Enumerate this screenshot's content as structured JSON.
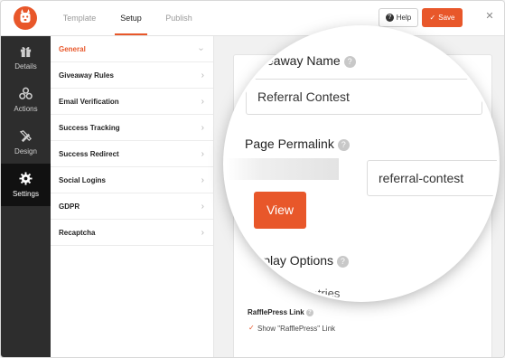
{
  "topbar": {
    "tabs": [
      {
        "label": "Template",
        "active": false
      },
      {
        "label": "Setup",
        "active": true
      },
      {
        "label": "Publish",
        "active": false
      }
    ],
    "help_label": "Help",
    "save_label": "Save",
    "close_glyph": "✕"
  },
  "leftnav": {
    "items": [
      {
        "label": "Details",
        "icon": "gift-icon",
        "active": false
      },
      {
        "label": "Actions",
        "icon": "actions-icon",
        "active": false
      },
      {
        "label": "Design",
        "icon": "design-icon",
        "active": false
      },
      {
        "label": "Settings",
        "icon": "gear-icon",
        "active": true
      }
    ]
  },
  "submenu": {
    "items": [
      {
        "label": "General",
        "active": true
      },
      {
        "label": "Giveaway Rules",
        "active": false
      },
      {
        "label": "Email Verification",
        "active": false
      },
      {
        "label": "Success Tracking",
        "active": false
      },
      {
        "label": "Success Redirect",
        "active": false
      },
      {
        "label": "Social Logins",
        "active": false
      },
      {
        "label": "GDPR",
        "active": false
      },
      {
        "label": "Recaptcha",
        "active": false
      }
    ]
  },
  "main": {
    "giveaway_name_label": "Giveaway Name",
    "giveaway_name_value": "Referral Contest",
    "permalink_label": "Page Permalink",
    "permalink_value": "referral-contest",
    "view_label": "View",
    "display_options_label": "Display Options",
    "limit_label": "Limit Total Entries",
    "rafflepress_link_label": "RafflePress Link",
    "show_rafflepress_label": "Show \"RafflePress\" Link"
  },
  "colors": {
    "accent": "#e8572a",
    "sidebar_dark": "#2d2d2d",
    "sidebar_active": "#111111"
  }
}
